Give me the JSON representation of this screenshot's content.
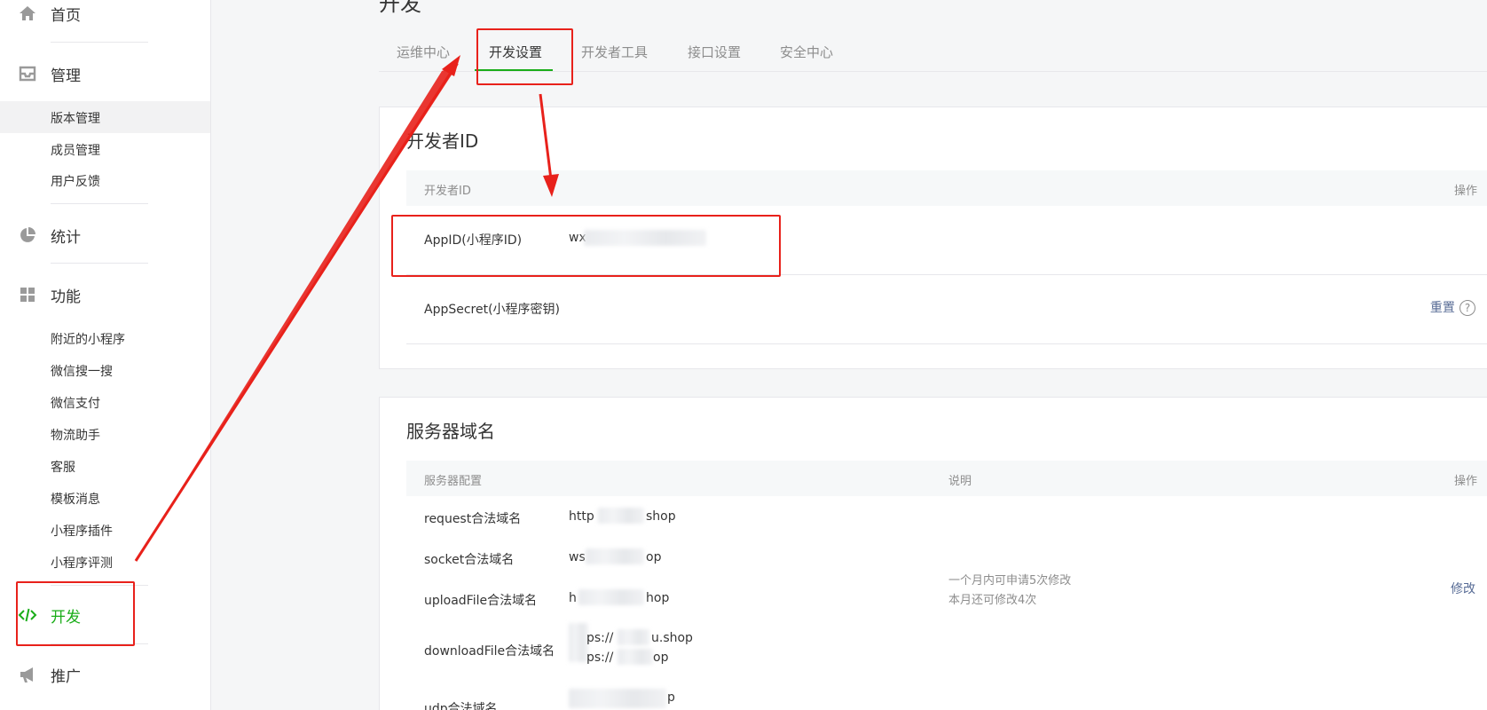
{
  "sidebar": {
    "home": {
      "label": "首页",
      "icon": "home-icon"
    },
    "manage": {
      "label": "管理",
      "icon": "inbox-icon",
      "items": [
        "版本管理",
        "成员管理",
        "用户反馈"
      ]
    },
    "stats": {
      "label": "统计",
      "icon": "pie-chart-icon"
    },
    "features": {
      "label": "功能",
      "icon": "grid-icon",
      "items": [
        "附近的小程序",
        "微信搜一搜",
        "微信支付",
        "物流助手",
        "客服",
        "模板消息",
        "小程序插件",
        "小程序评测"
      ]
    },
    "develop": {
      "label": "开发",
      "icon": "code-icon"
    },
    "promote": {
      "label": "推广",
      "icon": "megaphone-icon"
    }
  },
  "main": {
    "title": "开发",
    "tabs": [
      "运维中心",
      "开发设置",
      "开发者工具",
      "接口设置",
      "安全中心"
    ],
    "active_tab": "开发设置",
    "developer_card": {
      "title": "开发者ID",
      "headers": {
        "name": "开发者ID",
        "action": "操作"
      },
      "appid": {
        "label": "AppID(小程序ID)",
        "value_prefix": "wx"
      },
      "appsecret": {
        "label": "AppSecret(小程序密钥)",
        "action": "重置",
        "help": "?"
      }
    },
    "server_card": {
      "title": "服务器域名",
      "headers": {
        "config": "服务器配置",
        "desc": "说明",
        "action": "操作"
      },
      "rows": [
        {
          "label": "request合法域名",
          "value": "http",
          "suffix": "shop"
        },
        {
          "label": "socket合法域名",
          "value": "ws",
          "suffix": "op"
        },
        {
          "label": "uploadFile合法域名",
          "value": "h",
          "suffix": "hop"
        },
        {
          "label": "downloadFile合法域名",
          "value": "ps://",
          "suffix": "u.shop",
          "value2": "ps://",
          "suffix2": "op"
        },
        {
          "label": "udp合法域名",
          "value": "",
          "suffix": "p"
        }
      ],
      "desc_line1": "一个月内可申请5次修改",
      "desc_line2": "本月还可修改4次",
      "modify": "修改"
    }
  },
  "colors": {
    "accent_green": "#1aad19",
    "link": "#576b95",
    "annotation_red": "#e8211b"
  }
}
